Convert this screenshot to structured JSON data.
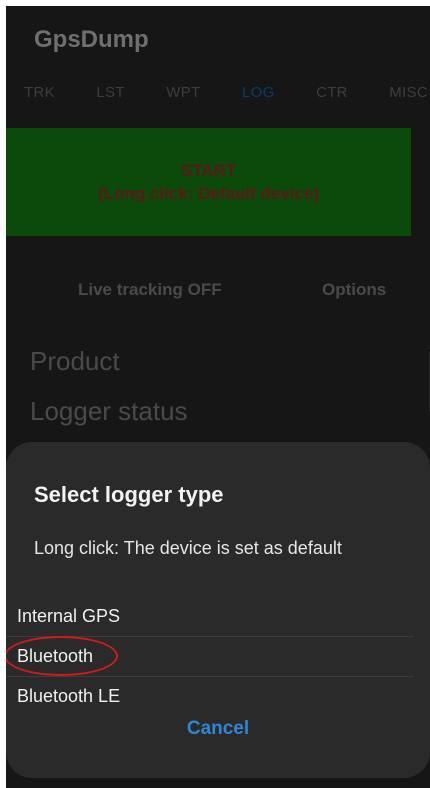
{
  "app": {
    "title": "GpsDump"
  },
  "tabs": [
    {
      "label": "TRK"
    },
    {
      "label": "LST"
    },
    {
      "label": "WPT"
    },
    {
      "label": "LOG"
    },
    {
      "label": "CTR"
    },
    {
      "label": "MISC"
    }
  ],
  "active_tab": "LOG",
  "start_panel": {
    "line1": "START",
    "line2": "(Long click: Default device)"
  },
  "buttons": {
    "live_tracking": "Live tracking OFF",
    "options": "Options"
  },
  "info": {
    "product_label": "Product",
    "logger_status_label": "Logger status"
  },
  "dialog": {
    "title": "Select logger type",
    "message": "Long click: The device is set as default",
    "options": [
      {
        "label": "Internal GPS"
      },
      {
        "label": "Bluetooth"
      },
      {
        "label": "Bluetooth LE"
      }
    ],
    "cancel_label": "Cancel"
  },
  "colors": {
    "start_bg": "#0c4a0c",
    "start_text": "#5c1818",
    "active_tab": "#0d3a66",
    "cancel": "#2f86d6",
    "highlight": "#d01b1b"
  }
}
